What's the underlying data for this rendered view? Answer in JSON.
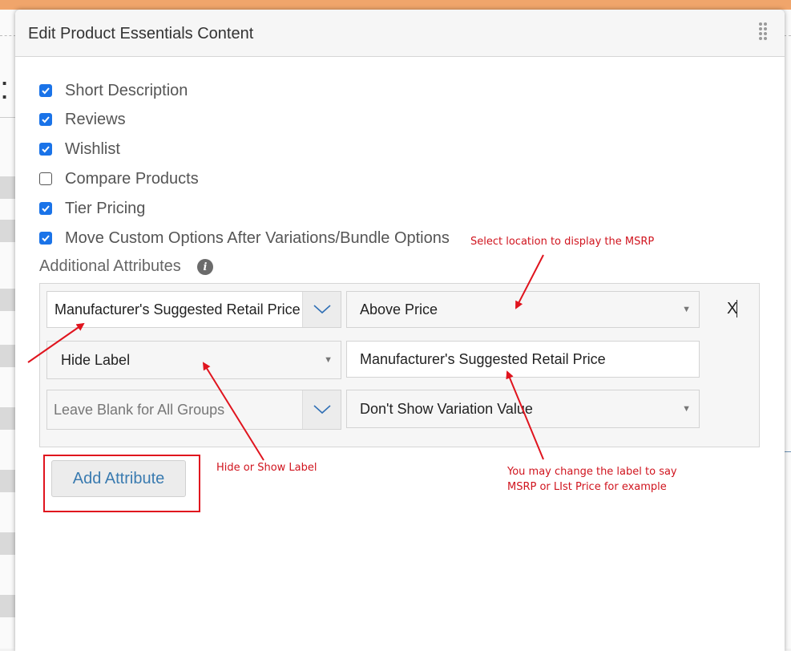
{
  "modal": {
    "title": "Edit Product Essentials Content",
    "drag_icon": "drag-handle-icon"
  },
  "options": [
    {
      "label": "Short Description",
      "checked": true
    },
    {
      "label": "Reviews",
      "checked": true
    },
    {
      "label": "Wishlist",
      "checked": true
    },
    {
      "label": "Compare Products",
      "checked": false
    },
    {
      "label": "Tier Pricing",
      "checked": true
    },
    {
      "label": "Move Custom Options After Variations/Bundle Options",
      "checked": true
    }
  ],
  "attributes": {
    "label": "Additional Attributes",
    "info_icon": "i",
    "attribute_select": "Manufacturer's Suggested Retail Price",
    "position_select": "Above Price",
    "label_display_select": "Hide Label",
    "label_text_value": "Manufacturer's Suggested Retail Price",
    "groups_placeholder": "Leave Blank for All Groups",
    "variation_select": "Don't Show Variation Value",
    "remove_label": "X"
  },
  "add_button_label": "Add Attribute",
  "annotations": {
    "msrp_location": "Select location to display the MSRP",
    "hide_show": "Hide or Show Label",
    "change_label_line1": "You may change the label to say",
    "change_label_line2": "MSRP or LIst Price for example"
  },
  "colors": {
    "checkbox_on": "#1a73e8",
    "annotation_red": "#e0141e",
    "button_text": "#3a7bb0"
  }
}
